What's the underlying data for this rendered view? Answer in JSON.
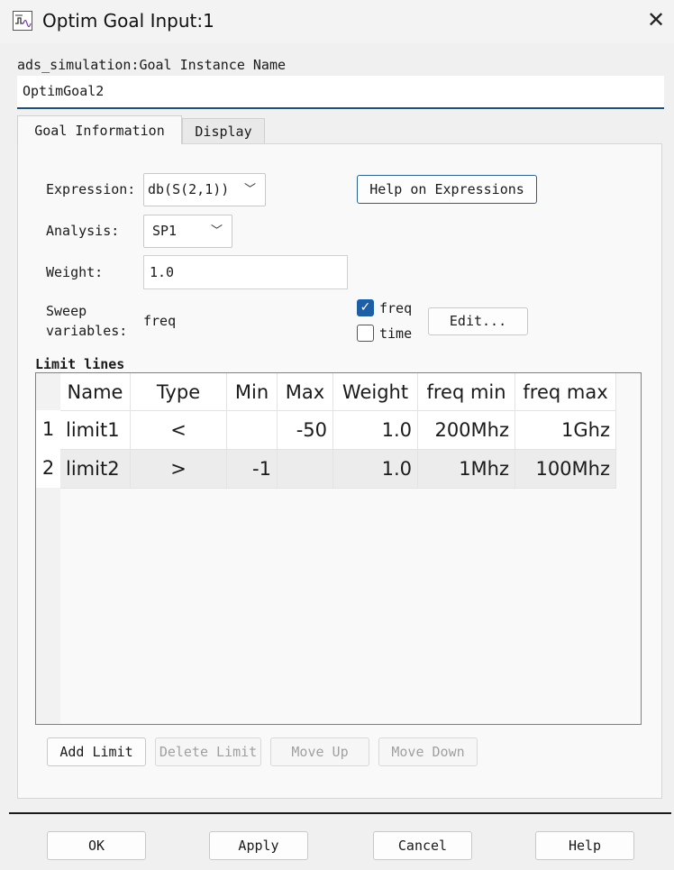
{
  "window": {
    "title": "Optim Goal Input:1",
    "close_symbol": "✕"
  },
  "instance": {
    "label": "ads_simulation:Goal Instance Name",
    "value": "OptimGoal2"
  },
  "tabs": [
    {
      "label": "Goal Information",
      "active": true
    },
    {
      "label": "Display",
      "active": false
    }
  ],
  "form": {
    "expression_label": "Expression:",
    "expression_value": "db(S(2,1))",
    "help_button": "Help on Expressions",
    "analysis_label": "Analysis:",
    "analysis_value": "SP1",
    "weight_label": "Weight:",
    "weight_value": "1.0",
    "sweep_label_line1": "Sweep",
    "sweep_label_line2": "variables:",
    "sweep_value": "freq",
    "sweep_options": [
      {
        "label": "freq",
        "checked": true
      },
      {
        "label": "time",
        "checked": false
      }
    ],
    "edit_button": "Edit..."
  },
  "limits": {
    "section_label": "Limit lines",
    "columns": [
      "Name",
      "Type",
      "Min",
      "Max",
      "Weight",
      "freq min",
      "freq max"
    ],
    "rows": [
      {
        "num": "1",
        "name": "limit1",
        "type": "<",
        "min": "",
        "max": "-50",
        "weight": "1.0",
        "fmin": "200Mhz",
        "fmax": "1Ghz"
      },
      {
        "num": "2",
        "name": "limit2",
        "type": ">",
        "min": "-1",
        "max": "",
        "weight": "1.0",
        "fmin": "1Mhz",
        "fmax": "100Mhz"
      }
    ]
  },
  "limit_buttons": {
    "add": "Add Limit",
    "delete": "Delete Limit",
    "up": "Move Up",
    "down": "Move Down"
  },
  "footer": {
    "ok": "OK",
    "apply": "Apply",
    "cancel": "Cancel",
    "help": "Help"
  },
  "colors": {
    "accent": "#1d5fa6",
    "field_underline": "#1f4e79"
  },
  "icons": {
    "app": "optim-goal-app-icon",
    "checkmark": "✓",
    "chevron": "﹀"
  }
}
